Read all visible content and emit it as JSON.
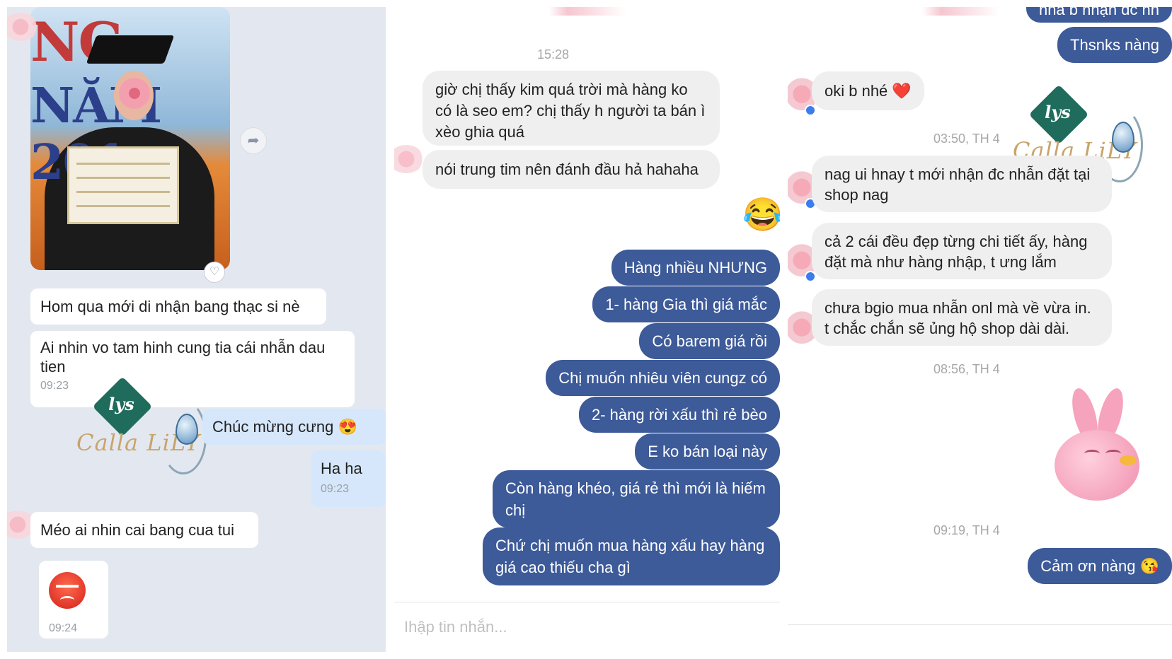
{
  "panel1": {
    "messages": [
      {
        "text": "Hom qua mới di nhận bang thạc si nè"
      },
      {
        "text": "Ai nhin vo tam hinh cung tia cái nhẫn dau tien",
        "time": "09:23"
      },
      {
        "text": "Chúc mừng cưng",
        "emoji": "😍"
      },
      {
        "text": "Ha ha",
        "time": "09:23"
      },
      {
        "text": "Méo ai nhin cai bang cua tui"
      },
      {
        "time": "09:24"
      }
    ]
  },
  "panel2": {
    "timestamp": "15:28",
    "incoming": [
      "giờ chị thấy kim quá trời mà hàng ko có là seo em? chị thấy h người ta bán ì xèo ghia quá",
      "nói trung tim nên đánh đầu hả hahaha"
    ],
    "reaction_emoji": "😂",
    "outgoing": [
      "Hàng nhiều NHƯNG",
      "1- hàng Gia thì giá mắc",
      "Có barem giá rồi",
      "Chị muốn nhiêu viên cungz có",
      "2- hàng rời xấu thì rẻ bèo",
      "E ko bán loại này",
      "Còn hàng khéo, giá rẻ thì mới là hiếm chị",
      "Chứ chị muốn mua hàng xấu hay hàng giá cao thiếu cha gì"
    ],
    "input_placeholder": "Ihập tin nhắn..."
  },
  "panel3": {
    "top_partial": "nha b nhận đc nh",
    "outgoing_1": "Thsnks nàng",
    "incoming_1": "oki b nhé",
    "incoming_1_emoji": "❤️",
    "timestamp_1": "03:50, TH 4",
    "incoming": [
      "nag ui hnay t mới nhận đc nhẫn đặt tại shop nag",
      "cả 2 cái đều đẹp từng chi tiết ấy, hàng đặt mà như hàng nhập, t ưng lắm",
      "chưa bgio mua nhẫn onl mà về vừa in. t chắc chắn sẽ ủng hộ shop dài dài."
    ],
    "timestamp_2": "08:56, TH 4",
    "timestamp_3": "09:19, TH 4",
    "outgoing_2": "Cảm ơn nàng",
    "outgoing_2_emoji": "😘"
  },
  "watermark": {
    "logo_mark": "lys",
    "brand": "Calla LiLY"
  },
  "icons": [
    "share-icon",
    "heart-icon",
    "angry-emoji-sticker",
    "pink-bird-sticker",
    "messenger-badge-icon"
  ],
  "colors": {
    "fb_out": "#3d5a99",
    "fb_in": "#efefef",
    "zalo_bg": "#e3e8f0",
    "zalo_out": "#d6e7fb"
  }
}
